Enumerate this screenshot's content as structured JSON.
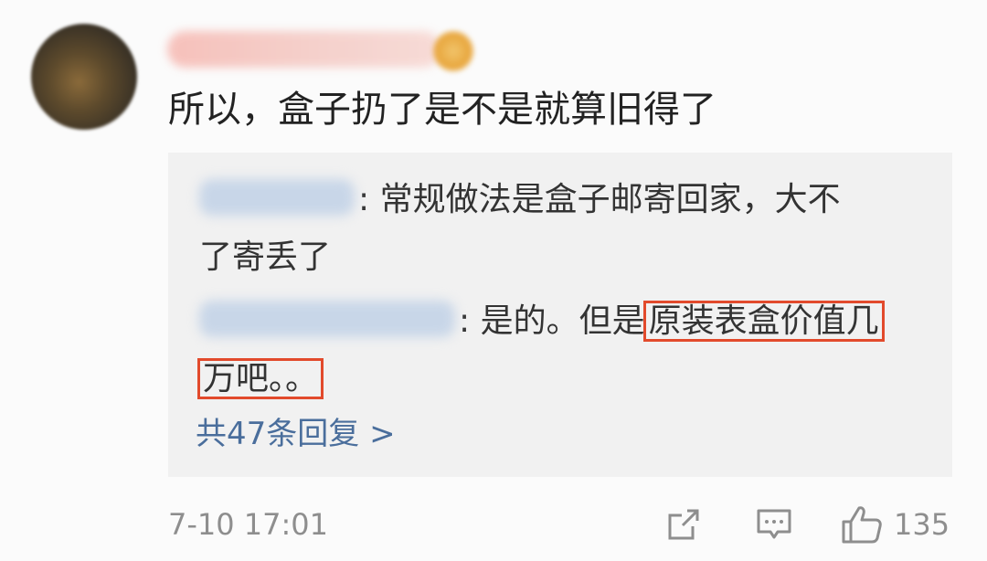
{
  "comment": {
    "text": "所以，盒子扔了是不是就算旧得了",
    "time": "7-10 17:01",
    "likes": "135"
  },
  "replies": [
    {
      "text_line1": ": 常规做法是盒子邮寄回家，大不",
      "text_line2": "了寄丢了"
    },
    {
      "text_before": ": 是的。但是",
      "text_hl1": "原装表盒价值几",
      "text_hl2": "万吧。。"
    }
  ],
  "more_replies": "共47条回复 >",
  "icons": [
    "share-icon",
    "comment-icon",
    "thumbs-up-icon"
  ],
  "colors": {
    "highlight_box": "#e24a2c",
    "link": "#4a6e9c"
  }
}
